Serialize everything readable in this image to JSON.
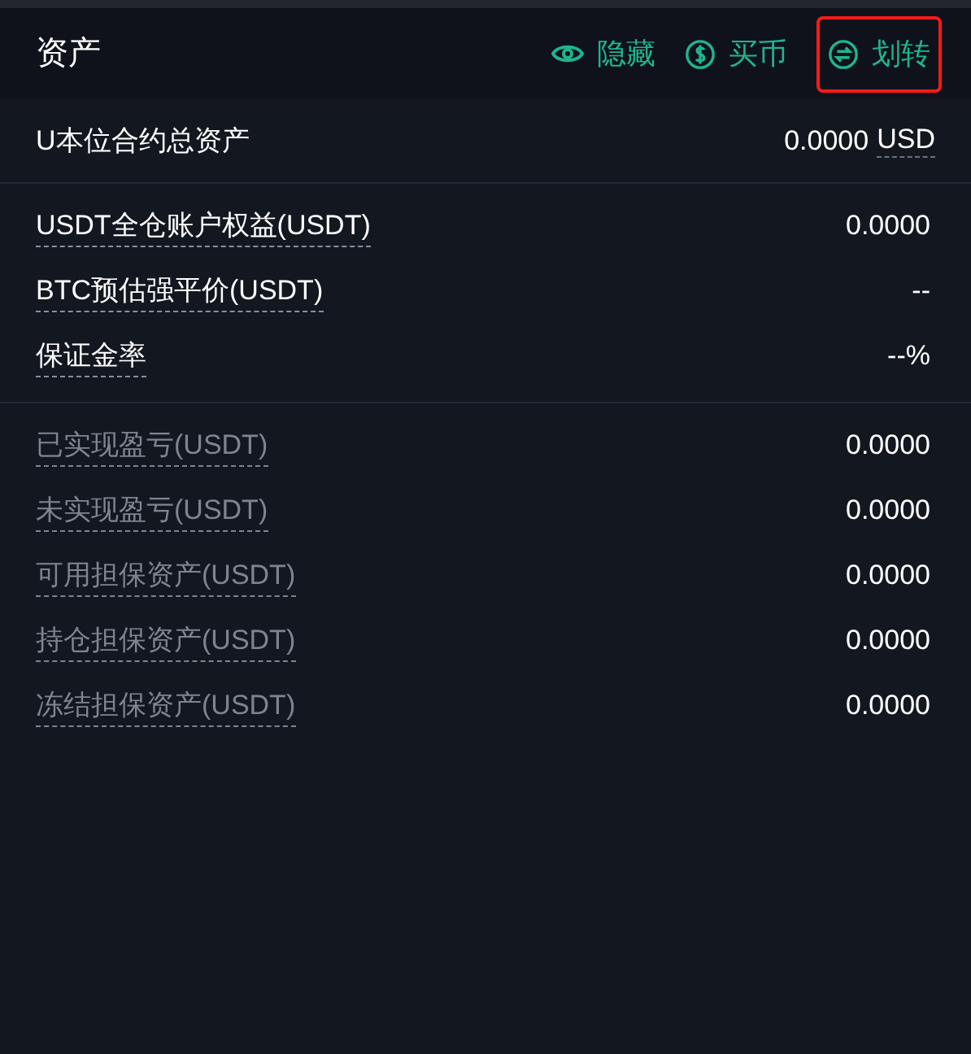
{
  "header": {
    "title": "资产",
    "actions": [
      {
        "kind": "eye",
        "label": "隐藏",
        "highlighted": false
      },
      {
        "kind": "dollar",
        "label": "买币",
        "highlighted": false
      },
      {
        "kind": "transfer",
        "label": "划转",
        "highlighted": true
      }
    ]
  },
  "total": {
    "label": "U本位合约总资产",
    "value": "0.0000",
    "unit": "USD"
  },
  "sections": [
    {
      "rows": [
        {
          "label": "USDT全仓账户权益(USDT)",
          "value": "0.0000",
          "dimmed": false
        },
        {
          "label": "BTC预估强平价(USDT)",
          "value": "--",
          "dimmed": false
        },
        {
          "label": "保证金率",
          "value": "--%",
          "dimmed": false
        }
      ]
    },
    {
      "rows": [
        {
          "label": "已实现盈亏(USDT)",
          "value": "0.0000",
          "dimmed": true
        },
        {
          "label": "未实现盈亏(USDT)",
          "value": "0.0000",
          "dimmed": true
        },
        {
          "label": "可用担保资产(USDT)",
          "value": "0.0000",
          "dimmed": true
        },
        {
          "label": "持仓担保资产(USDT)",
          "value": "0.0000",
          "dimmed": true
        },
        {
          "label": "冻结担保资产(USDT)",
          "value": "0.0000",
          "dimmed": true
        }
      ]
    }
  ]
}
